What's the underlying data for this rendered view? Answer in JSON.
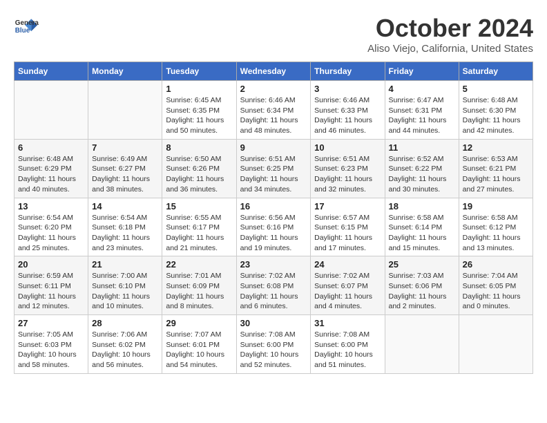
{
  "header": {
    "logo_line1": "General",
    "logo_line2": "Blue",
    "month_title": "October 2024",
    "location": "Aliso Viejo, California, United States"
  },
  "weekdays": [
    "Sunday",
    "Monday",
    "Tuesday",
    "Wednesday",
    "Thursday",
    "Friday",
    "Saturday"
  ],
  "weeks": [
    [
      {
        "day": "",
        "empty": true
      },
      {
        "day": "",
        "empty": true
      },
      {
        "day": "1",
        "sunrise": "6:45 AM",
        "sunset": "6:35 PM",
        "daylight": "11 hours and 50 minutes."
      },
      {
        "day": "2",
        "sunrise": "6:46 AM",
        "sunset": "6:34 PM",
        "daylight": "11 hours and 48 minutes."
      },
      {
        "day": "3",
        "sunrise": "6:46 AM",
        "sunset": "6:33 PM",
        "daylight": "11 hours and 46 minutes."
      },
      {
        "day": "4",
        "sunrise": "6:47 AM",
        "sunset": "6:31 PM",
        "daylight": "11 hours and 44 minutes."
      },
      {
        "day": "5",
        "sunrise": "6:48 AM",
        "sunset": "6:30 PM",
        "daylight": "11 hours and 42 minutes."
      }
    ],
    [
      {
        "day": "6",
        "sunrise": "6:48 AM",
        "sunset": "6:29 PM",
        "daylight": "11 hours and 40 minutes."
      },
      {
        "day": "7",
        "sunrise": "6:49 AM",
        "sunset": "6:27 PM",
        "daylight": "11 hours and 38 minutes."
      },
      {
        "day": "8",
        "sunrise": "6:50 AM",
        "sunset": "6:26 PM",
        "daylight": "11 hours and 36 minutes."
      },
      {
        "day": "9",
        "sunrise": "6:51 AM",
        "sunset": "6:25 PM",
        "daylight": "11 hours and 34 minutes."
      },
      {
        "day": "10",
        "sunrise": "6:51 AM",
        "sunset": "6:23 PM",
        "daylight": "11 hours and 32 minutes."
      },
      {
        "day": "11",
        "sunrise": "6:52 AM",
        "sunset": "6:22 PM",
        "daylight": "11 hours and 30 minutes."
      },
      {
        "day": "12",
        "sunrise": "6:53 AM",
        "sunset": "6:21 PM",
        "daylight": "11 hours and 27 minutes."
      }
    ],
    [
      {
        "day": "13",
        "sunrise": "6:54 AM",
        "sunset": "6:20 PM",
        "daylight": "11 hours and 25 minutes."
      },
      {
        "day": "14",
        "sunrise": "6:54 AM",
        "sunset": "6:18 PM",
        "daylight": "11 hours and 23 minutes."
      },
      {
        "day": "15",
        "sunrise": "6:55 AM",
        "sunset": "6:17 PM",
        "daylight": "11 hours and 21 minutes."
      },
      {
        "day": "16",
        "sunrise": "6:56 AM",
        "sunset": "6:16 PM",
        "daylight": "11 hours and 19 minutes."
      },
      {
        "day": "17",
        "sunrise": "6:57 AM",
        "sunset": "6:15 PM",
        "daylight": "11 hours and 17 minutes."
      },
      {
        "day": "18",
        "sunrise": "6:58 AM",
        "sunset": "6:14 PM",
        "daylight": "11 hours and 15 minutes."
      },
      {
        "day": "19",
        "sunrise": "6:58 AM",
        "sunset": "6:12 PM",
        "daylight": "11 hours and 13 minutes."
      }
    ],
    [
      {
        "day": "20",
        "sunrise": "6:59 AM",
        "sunset": "6:11 PM",
        "daylight": "11 hours and 12 minutes."
      },
      {
        "day": "21",
        "sunrise": "7:00 AM",
        "sunset": "6:10 PM",
        "daylight": "11 hours and 10 minutes."
      },
      {
        "day": "22",
        "sunrise": "7:01 AM",
        "sunset": "6:09 PM",
        "daylight": "11 hours and 8 minutes."
      },
      {
        "day": "23",
        "sunrise": "7:02 AM",
        "sunset": "6:08 PM",
        "daylight": "11 hours and 6 minutes."
      },
      {
        "day": "24",
        "sunrise": "7:02 AM",
        "sunset": "6:07 PM",
        "daylight": "11 hours and 4 minutes."
      },
      {
        "day": "25",
        "sunrise": "7:03 AM",
        "sunset": "6:06 PM",
        "daylight": "11 hours and 2 minutes."
      },
      {
        "day": "26",
        "sunrise": "7:04 AM",
        "sunset": "6:05 PM",
        "daylight": "11 hours and 0 minutes."
      }
    ],
    [
      {
        "day": "27",
        "sunrise": "7:05 AM",
        "sunset": "6:03 PM",
        "daylight": "10 hours and 58 minutes."
      },
      {
        "day": "28",
        "sunrise": "7:06 AM",
        "sunset": "6:02 PM",
        "daylight": "10 hours and 56 minutes."
      },
      {
        "day": "29",
        "sunrise": "7:07 AM",
        "sunset": "6:01 PM",
        "daylight": "10 hours and 54 minutes."
      },
      {
        "day": "30",
        "sunrise": "7:08 AM",
        "sunset": "6:00 PM",
        "daylight": "10 hours and 52 minutes."
      },
      {
        "day": "31",
        "sunrise": "7:08 AM",
        "sunset": "6:00 PM",
        "daylight": "10 hours and 51 minutes."
      },
      {
        "day": "",
        "empty": true
      },
      {
        "day": "",
        "empty": true
      }
    ]
  ],
  "labels": {
    "sunrise": "Sunrise:",
    "sunset": "Sunset:",
    "daylight": "Daylight:"
  }
}
